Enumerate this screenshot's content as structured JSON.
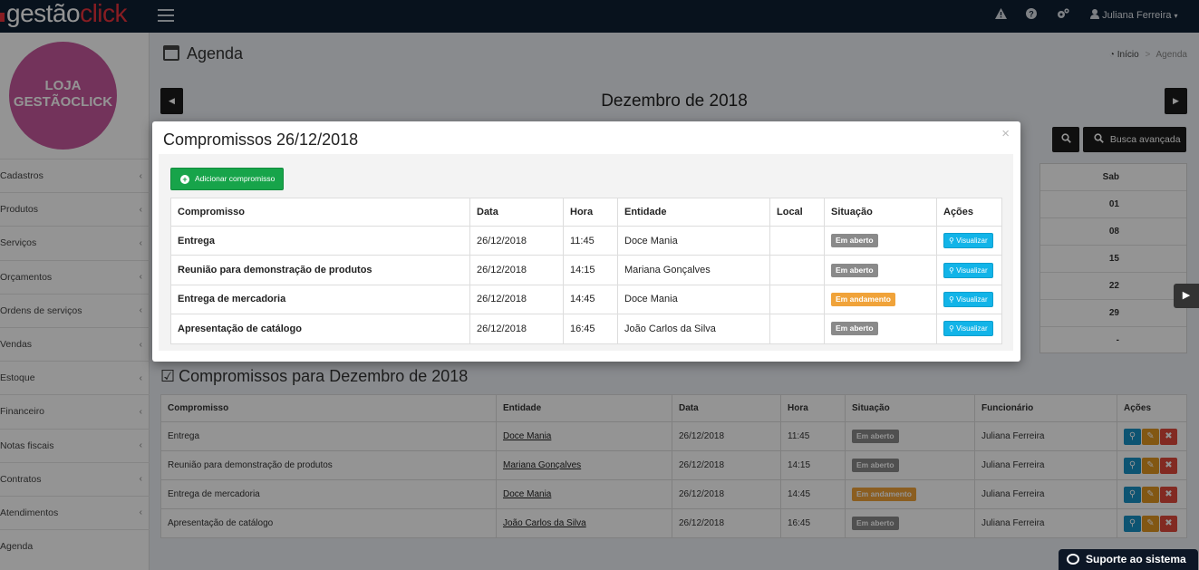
{
  "topbar": {
    "logo_part1": "gestão",
    "logo_part2": "click",
    "user_name": "Juliana Ferreira"
  },
  "sidebar": {
    "store_line1": "LOJA",
    "store_line2": "GESTÃOCLICK",
    "items": [
      {
        "label": "Cadastros",
        "has_children": true
      },
      {
        "label": "Produtos",
        "has_children": true
      },
      {
        "label": "Serviços",
        "has_children": true
      },
      {
        "label": "Orçamentos",
        "has_children": true
      },
      {
        "label": "Ordens de serviços",
        "has_children": true
      },
      {
        "label": "Vendas",
        "has_children": true
      },
      {
        "label": "Estoque",
        "has_children": true
      },
      {
        "label": "Financeiro",
        "has_children": true
      },
      {
        "label": "Notas fiscais",
        "has_children": true
      },
      {
        "label": "Contratos",
        "has_children": true
      },
      {
        "label": "Atendimentos",
        "has_children": true
      },
      {
        "label": "Agenda",
        "has_children": false
      }
    ]
  },
  "header": {
    "title": "Agenda",
    "breadcrumb_home": "Início",
    "breadcrumb_sep": ">",
    "breadcrumb_current": "Agenda"
  },
  "calendar": {
    "month_label": "Dezembro de 2018",
    "advanced_search_label": "Busca avançada",
    "column_head": "Sab",
    "column_values": [
      "01",
      "08",
      "15",
      "22",
      "29",
      "-"
    ]
  },
  "list": {
    "title": "Compromissos para Dezembro de 2018",
    "headers": [
      "Compromisso",
      "Entidade",
      "Data",
      "Hora",
      "Situação",
      "Funcionário",
      "Ações"
    ],
    "rows": [
      {
        "compromisso": "Entrega",
        "entidade": "Doce Mania",
        "data": "26/12/2018",
        "hora": "11:45",
        "situacao": "Em aberto",
        "status": "open",
        "funcionario": "Juliana Ferreira"
      },
      {
        "compromisso": "Reunião para demonstração de produtos",
        "entidade": "Mariana Gonçalves",
        "data": "26/12/2018",
        "hora": "14:15",
        "situacao": "Em aberto",
        "status": "open",
        "funcionario": "Juliana Ferreira"
      },
      {
        "compromisso": "Entrega de mercadoria",
        "entidade": "Doce Mania",
        "data": "26/12/2018",
        "hora": "14:45",
        "situacao": "Em andamento",
        "status": "progress",
        "funcionario": "Juliana Ferreira"
      },
      {
        "compromisso": "Apresentação de catálogo",
        "entidade": "João Carlos da Silva",
        "data": "26/12/2018",
        "hora": "16:45",
        "situacao": "Em aberto",
        "status": "open",
        "funcionario": "Juliana Ferreira"
      }
    ]
  },
  "modal": {
    "title": "Compromissos 26/12/2018",
    "close_label": "×",
    "add_label": "Adicionar compromisso",
    "view_label": "Visualizar",
    "headers": [
      "Compromisso",
      "Data",
      "Hora",
      "Entidade",
      "Local",
      "Situação",
      "Ações"
    ],
    "rows": [
      {
        "compromisso": "Entrega",
        "data": "26/12/2018",
        "hora": "11:45",
        "entidade": "Doce Mania",
        "local": "",
        "situacao": "Em aberto",
        "status": "open"
      },
      {
        "compromisso": "Reunião para demonstração de produtos",
        "data": "26/12/2018",
        "hora": "14:15",
        "entidade": "Mariana Gonçalves",
        "local": "",
        "situacao": "Em aberto",
        "status": "open"
      },
      {
        "compromisso": "Entrega de mercadoria",
        "data": "26/12/2018",
        "hora": "14:45",
        "entidade": "Doce Mania",
        "local": "",
        "situacao": "Em andamento",
        "status": "progress"
      },
      {
        "compromisso": "Apresentação de catálogo",
        "data": "26/12/2018",
        "hora": "16:45",
        "entidade": "João Carlos da Silva",
        "local": "",
        "situacao": "Em aberto",
        "status": "open"
      }
    ]
  },
  "support": {
    "label": "Suporte ao sistema"
  },
  "icons": {
    "hamburger": "menu-icon",
    "alert": "warning-icon",
    "help": "question-icon",
    "settings": "gears-icon",
    "user": "user-icon",
    "calendar": "calendar-icon",
    "home": "dashboard-icon",
    "search": "search-icon",
    "check": "check-square-icon",
    "edit": "edit-icon",
    "delete": "times-icon",
    "toggle": "play-square-icon",
    "chat": "chat-icon"
  },
  "colors": {
    "topbar": "#0f1f33",
    "brand_red": "#e8323c",
    "store_badge": "#c7599d",
    "add_green": "#17a44a",
    "view_blue": "#12b4e8",
    "status_open": "#8a8a8a",
    "status_progress": "#f0a33a"
  }
}
